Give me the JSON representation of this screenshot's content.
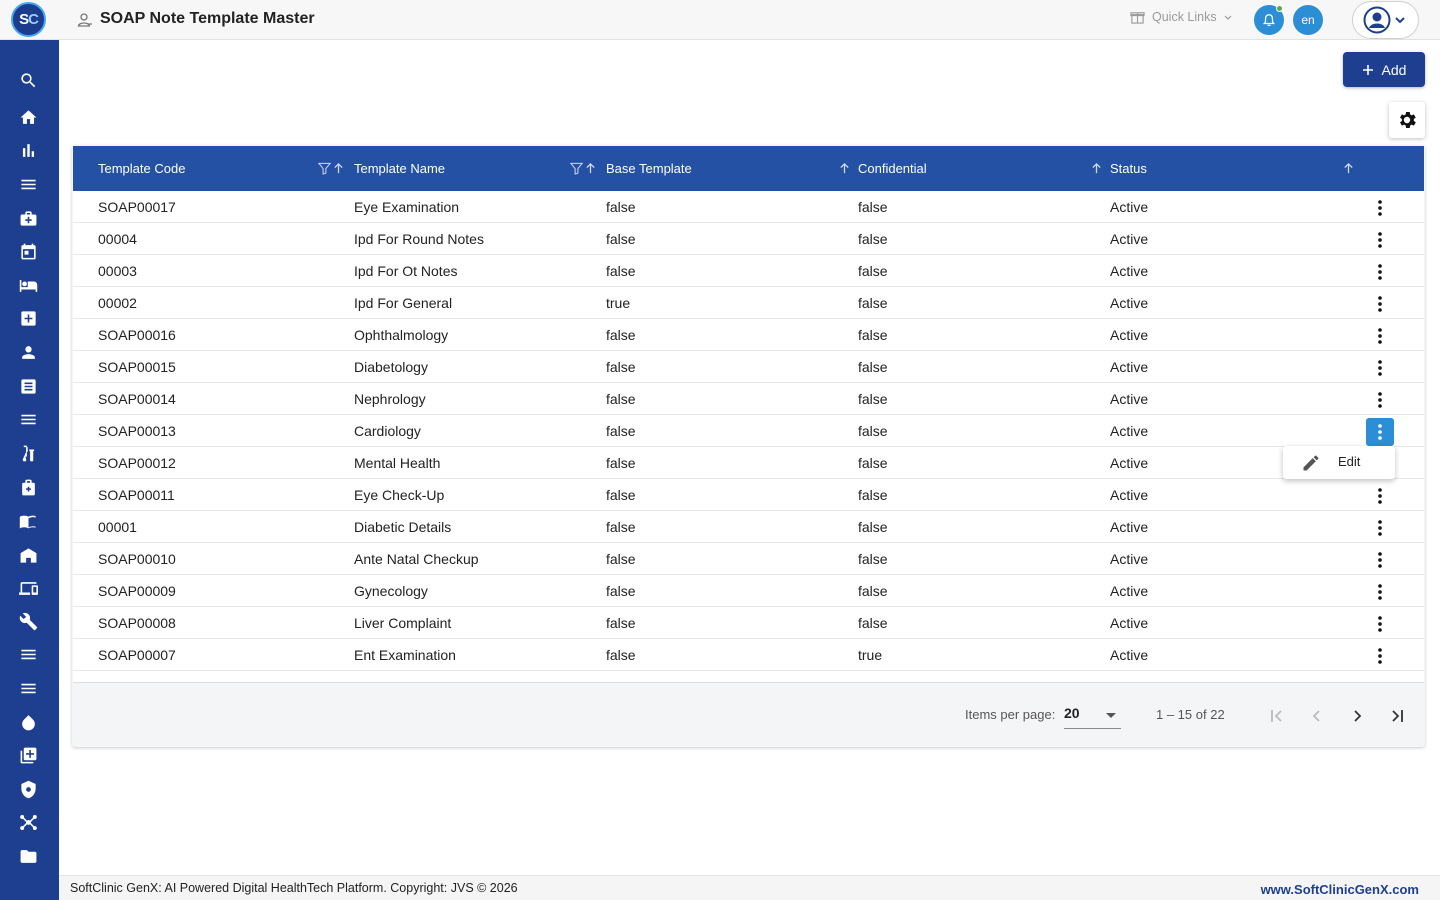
{
  "app": {
    "logo_text_s": "S",
    "logo_text_c": "C",
    "page_title": "SOAP Note Template Master",
    "quick_links_label": "Quick Links",
    "language": "en"
  },
  "sidebar": {
    "icons": [
      "search-icon",
      "home-icon",
      "bar-chart-icon",
      "menu-icon",
      "medical-bag-icon",
      "calendar-icon",
      "bed-icon",
      "medical-plus-icon",
      "person-icon",
      "document-icon",
      "menu-icon",
      "lab-icon",
      "pharmacy-icon",
      "book-icon",
      "store-icon",
      "devices-icon",
      "wrench-icon",
      "menu-icon",
      "menu-icon",
      "drop-icon",
      "add-box-icon",
      "shield-icon",
      "network-icon",
      "folder-icon"
    ]
  },
  "toolbar": {
    "add_label": "Add"
  },
  "table": {
    "columns": [
      "Template Code",
      "Template Name",
      "Base Template",
      "Confidential",
      "Status"
    ],
    "rows": [
      [
        "SOAP00017",
        "Eye Examination",
        "false",
        "false",
        "Active"
      ],
      [
        "00004",
        "Ipd For Round Notes",
        "false",
        "false",
        "Active"
      ],
      [
        "00003",
        "Ipd For Ot Notes",
        "false",
        "false",
        "Active"
      ],
      [
        "00002",
        "Ipd For General",
        "true",
        "false",
        "Active"
      ],
      [
        "SOAP00016",
        "Ophthalmology",
        "false",
        "false",
        "Active"
      ],
      [
        "SOAP00015",
        "Diabetology",
        "false",
        "false",
        "Active"
      ],
      [
        "SOAP00014",
        "Nephrology",
        "false",
        "false",
        "Active"
      ],
      [
        "SOAP00013",
        "Cardiology",
        "false",
        "false",
        "Active"
      ],
      [
        "SOAP00012",
        "Mental Health",
        "false",
        "false",
        "Active"
      ],
      [
        "SOAP00011",
        "Eye Check-Up",
        "false",
        "false",
        "Active"
      ],
      [
        "00001",
        "Diabetic Details",
        "false",
        "false",
        "Active"
      ],
      [
        "SOAP00010",
        "Ante Natal Checkup",
        "false",
        "false",
        "Active"
      ],
      [
        "SOAP00009",
        "Gynecology",
        "false",
        "false",
        "Active"
      ],
      [
        "SOAP00008",
        "Liver Complaint",
        "false",
        "false",
        "Active"
      ],
      [
        "SOAP00007",
        "Ent Examination",
        "false",
        "true",
        "Active"
      ]
    ],
    "active_row_index": 7
  },
  "row_menu": {
    "edit_label": "Edit"
  },
  "paginator": {
    "items_per_page_label": "Items per page:",
    "items_per_page_value": "20",
    "range_label": "1 – 15 of 22"
  },
  "footer": {
    "copyright": "SoftClinic GenX: AI Powered Digital HealthTech Platform. Copyright: JVS © 2026",
    "website": "www.SoftClinicGenX.com"
  },
  "colors": {
    "sidebar": "#1e3f8f",
    "table_header": "#2451a3",
    "accent": "#2c8fd6"
  }
}
